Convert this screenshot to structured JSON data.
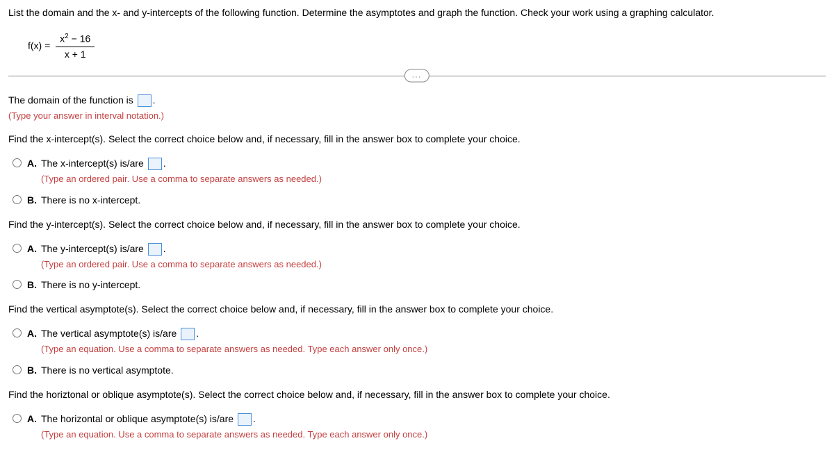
{
  "question": "List the domain and the x- and y-intercepts of the following function. Determine the asymptotes and graph the function. Check your work using a graphing calculator.",
  "equation": {
    "lhs": "f(x) =",
    "num_a": "x",
    "num_exp": "2",
    "num_b": " − 16",
    "den": "x + 1"
  },
  "dots": "...",
  "domain": {
    "prompt_a": "The domain of the function is ",
    "prompt_b": ".",
    "hint": "(Type your answer in interval notation.)"
  },
  "xint": {
    "prompt": "Find the x-intercept(s). Select the correct choice below and, if necessary, fill in the answer box to complete your choice.",
    "a_label": "A.",
    "a_text_a": "The x-intercept(s) is/are ",
    "a_text_b": ".",
    "a_hint": "(Type an ordered pair. Use a comma to separate answers as needed.)",
    "b_label": "B.",
    "b_text": "There is no x-intercept."
  },
  "yint": {
    "prompt": "Find the y-intercept(s). Select the correct choice below and, if necessary, fill in the answer box to complete your choice.",
    "a_label": "A.",
    "a_text_a": "The y-intercept(s) is/are ",
    "a_text_b": ".",
    "a_hint": "(Type an ordered pair. Use a comma to separate answers as needed.)",
    "b_label": "B.",
    "b_text": "There is no y-intercept."
  },
  "vasym": {
    "prompt": "Find the vertical asymptote(s). Select the correct choice below and, if necessary, fill in the answer box to complete your choice.",
    "a_label": "A.",
    "a_text_a": "The vertical asymptote(s) is/are ",
    "a_text_b": ".",
    "a_hint": "(Type an equation. Use a comma to separate answers as needed. Type each answer only once.)",
    "b_label": "B.",
    "b_text": "There is no vertical asymptote."
  },
  "hasym": {
    "prompt": "Find the horiztonal or oblique asymptote(s). Select the correct choice below and, if necessary, fill in the answer box to complete your choice.",
    "a_label": "A.",
    "a_text_a": "The horizontal or oblique asymptote(s) is/are ",
    "a_text_b": ".",
    "a_hint": "(Type an equation. Use a comma to separate answers as needed. Type each answer only once.)"
  }
}
